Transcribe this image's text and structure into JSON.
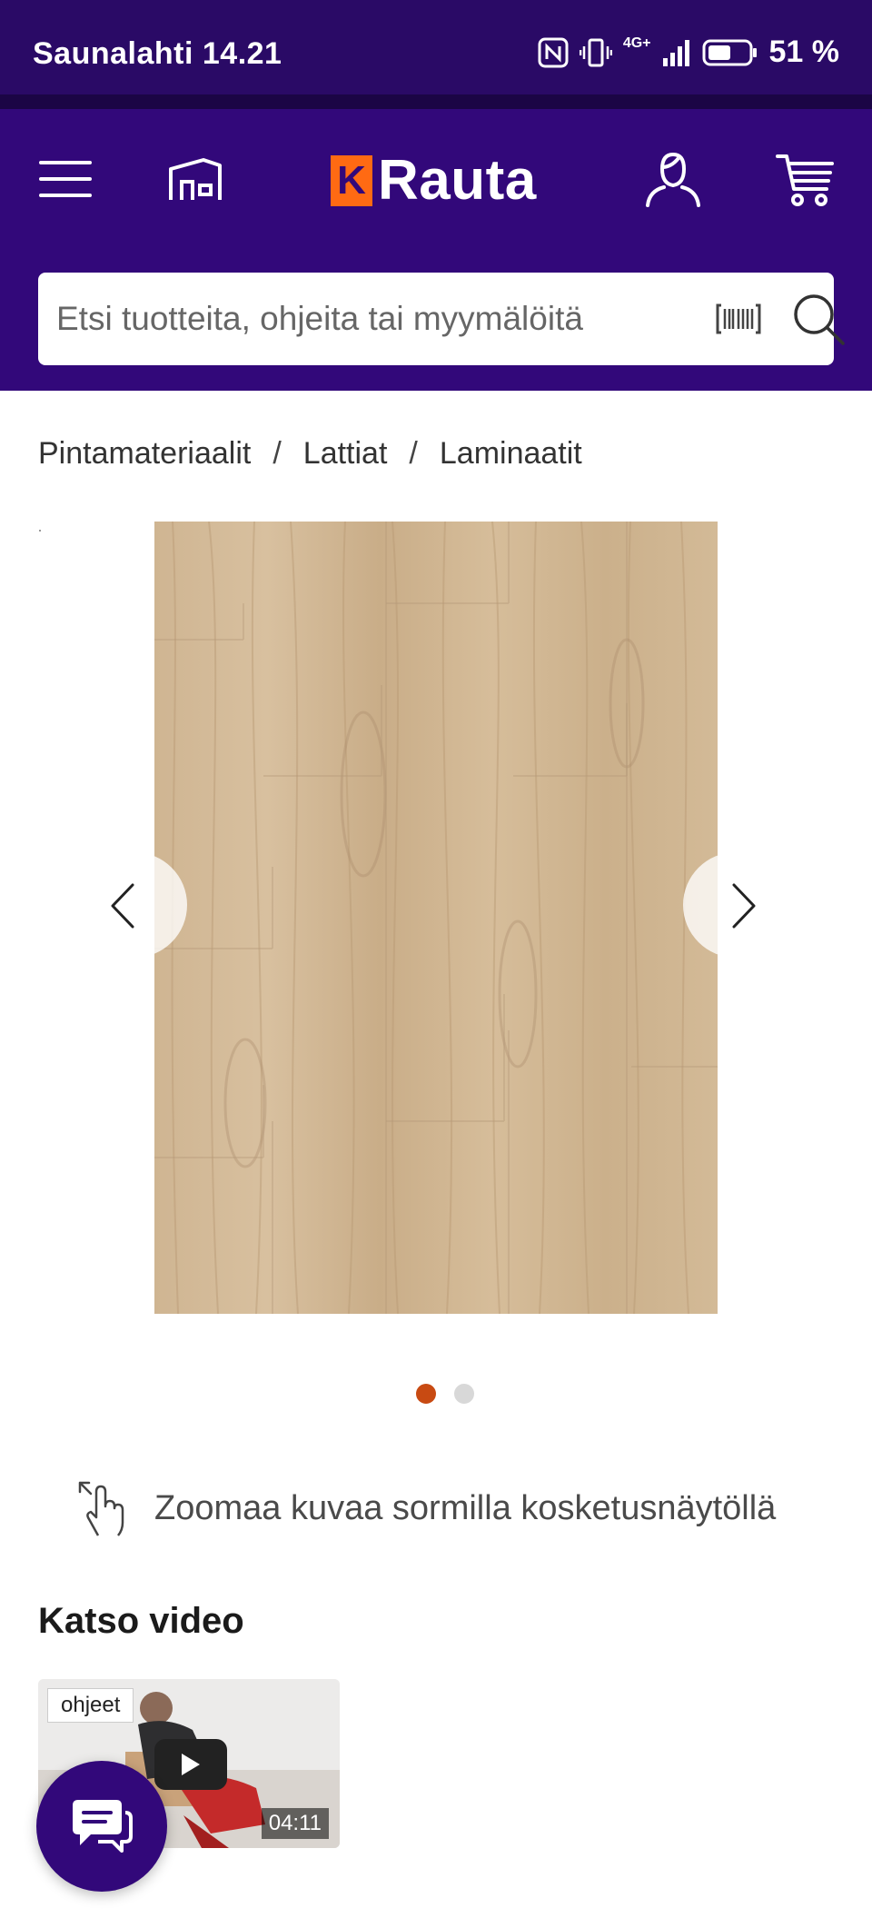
{
  "status_bar": {
    "carrier_time": "Saunalahti 14.21",
    "network": "4G+",
    "battery": "51 %"
  },
  "header": {
    "logo_k": "K",
    "logo_text": "Rauta",
    "icons": [
      "menu-icon",
      "store-icon",
      "user-icon",
      "cart-icon"
    ]
  },
  "search": {
    "placeholder": "Etsi tuotteita, ohjeita tai myymälöitä"
  },
  "breadcrumb": {
    "items": [
      "Pintamateriaalit",
      "Lattiat",
      "Laminaatit"
    ],
    "separator": "/"
  },
  "gallery": {
    "image_count": 2,
    "active_index": 0,
    "active_dot_color": "#c84a12"
  },
  "zoom_hint": {
    "text": "Zoomaa kuvaa sormilla kosketusnäytöllä"
  },
  "video": {
    "section_title": "Katso video",
    "tag": "ohjeet",
    "duration": "04:11"
  },
  "colors": {
    "brand_purple": "#32087a",
    "brand_orange": "#ff6a13"
  }
}
